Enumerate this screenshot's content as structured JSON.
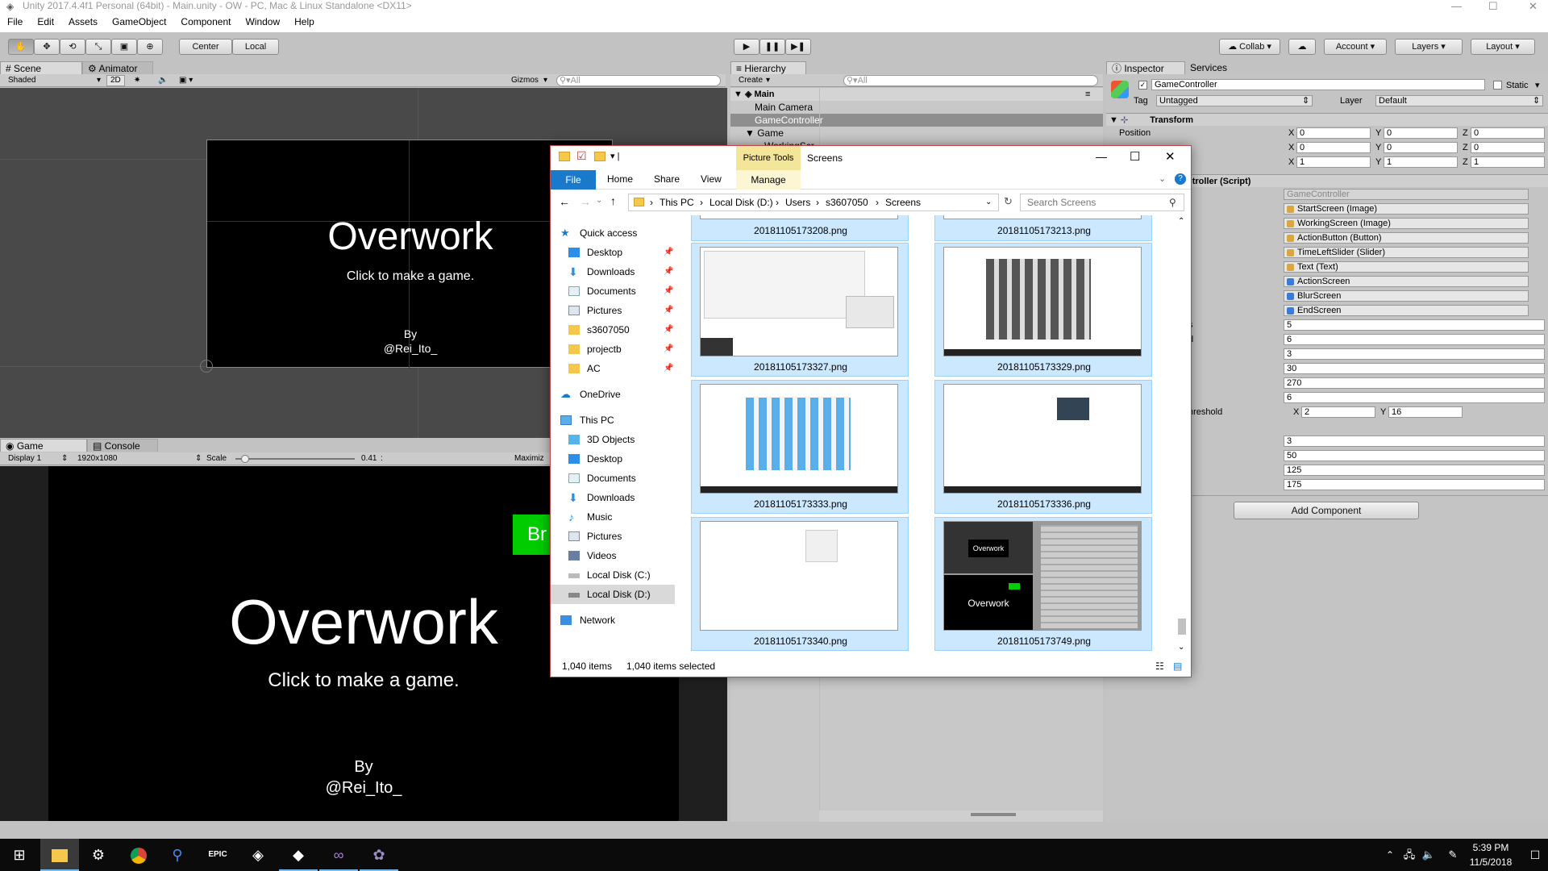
{
  "window_title": "Unity 2017.4.4f1 Personal (64bit) - Main.unity - OW - PC, Mac & Linux Standalone <DX11>",
  "menu": [
    "File",
    "Edit",
    "Assets",
    "GameObject",
    "Component",
    "Window",
    "Help"
  ],
  "toolbar": {
    "pivot_center": "Center",
    "pivot_local": "Local",
    "collab": "Collab",
    "account": "Account",
    "layers": "Layers",
    "layout": "Layout"
  },
  "scene": {
    "tab_scene": "Scene",
    "tab_animator": "Animator",
    "shading": "Shaded",
    "mode_2d": "2D",
    "gizmos": "Gizmos",
    "search": "All",
    "canvas_title": "Overwork",
    "canvas_subtitle": "Click to make a game.",
    "canvas_by": "By",
    "canvas_author": "@Rei_Ito_"
  },
  "game": {
    "tab_game": "Game",
    "tab_console": "Console",
    "display": "Display 1",
    "resolution": "1920x1080",
    "scale_label": "Scale",
    "scale_value": "0.41",
    "scale_fraction": 0.08,
    "maximize": "Maximiz",
    "title": "Overwork",
    "subtitle": "Click to make a game.",
    "by": "By",
    "author": "@Rei_Ito_",
    "green_button": "Br",
    "green_color": "#00cc00"
  },
  "hierarchy": {
    "tab": "Hierarchy",
    "create": "Create",
    "search": "All",
    "scene_name": "Main",
    "items": [
      "Main Camera",
      "GameController",
      "Game"
    ],
    "partial_item": "WorkingScr"
  },
  "inspector": {
    "tab": "Inspector",
    "tab_services": "Services",
    "object_name": "GameController",
    "static_label": "Static",
    "tag_label": "Tag",
    "tag_value": "Untagged",
    "layer_label": "Layer",
    "layer_value": "Default",
    "transform_title": "Transform",
    "position_label": "Position",
    "rows": [
      {
        "x": "0",
        "y": "0",
        "z": "0"
      },
      {
        "x": "0",
        "y": "0",
        "z": "0"
      },
      {
        "x": "1",
        "y": "1",
        "z": "1"
      }
    ],
    "axis_x": "X",
    "axis_y": "Y",
    "axis_z": "Z",
    "script_title": "ntroller (Script)",
    "script_ref": "GameController",
    "refs": [
      "StartScreen (Image)",
      "WorkingScreen (Image)",
      "ActionButton (Button)",
      "TimeLeftSlider (Slider)",
      "Text (Text)",
      "ActionScreen",
      "BlurScreen",
      "EndScreen"
    ],
    "values_a": [
      "5",
      "6",
      "3",
      "30",
      "270",
      "6"
    ],
    "label_s": "s",
    "label_d": "d",
    "threshold_label": "hreshold",
    "threshold_x": "2",
    "threshold_y": "16",
    "values_b": [
      "3",
      "50",
      "125",
      "175"
    ],
    "add_component": "Add Component"
  },
  "explorer": {
    "ribbon_context": "Picture Tools",
    "title": "Screens",
    "tabs": [
      "File",
      "Home",
      "Share",
      "View"
    ],
    "manage": "Manage",
    "breadcrumb": [
      "This PC",
      "Local Disk (D:)",
      "Users",
      "s3607050",
      "Screens"
    ],
    "search_placeholder": "Search Screens",
    "nav": [
      {
        "label": "Quick access",
        "pin": false,
        "section": true
      },
      {
        "label": "Desktop",
        "pin": true
      },
      {
        "label": "Downloads",
        "pin": true
      },
      {
        "label": "Documents",
        "pin": true
      },
      {
        "label": "Pictures",
        "pin": true
      },
      {
        "label": "s3607050",
        "pin": true
      },
      {
        "label": "projectb",
        "pin": true
      },
      {
        "label": "AC",
        "pin": true
      },
      {
        "label": "OneDrive",
        "section": true
      },
      {
        "label": "This PC",
        "section": true
      },
      {
        "label": "3D Objects"
      },
      {
        "label": "Desktop"
      },
      {
        "label": "Documents"
      },
      {
        "label": "Downloads"
      },
      {
        "label": "Music"
      },
      {
        "label": "Pictures"
      },
      {
        "label": "Videos"
      },
      {
        "label": "Local Disk (C:)"
      },
      {
        "label": "Local Disk (D:)",
        "selected": true
      },
      {
        "label": "Network",
        "section": true
      }
    ],
    "files_top": [
      "20181105173208.png",
      "20181105173213.png"
    ],
    "files": [
      "20181105173327.png",
      "20181105173329.png",
      "20181105173333.png",
      "20181105173336.png",
      "20181105173340.png",
      "20181105173749.png"
    ],
    "thumb_title": "Overwork",
    "status_items": "1,040 items",
    "status_selected": "1,040 items selected"
  },
  "taskbar": {
    "time": "5:39 PM",
    "date": "11/5/2018"
  }
}
